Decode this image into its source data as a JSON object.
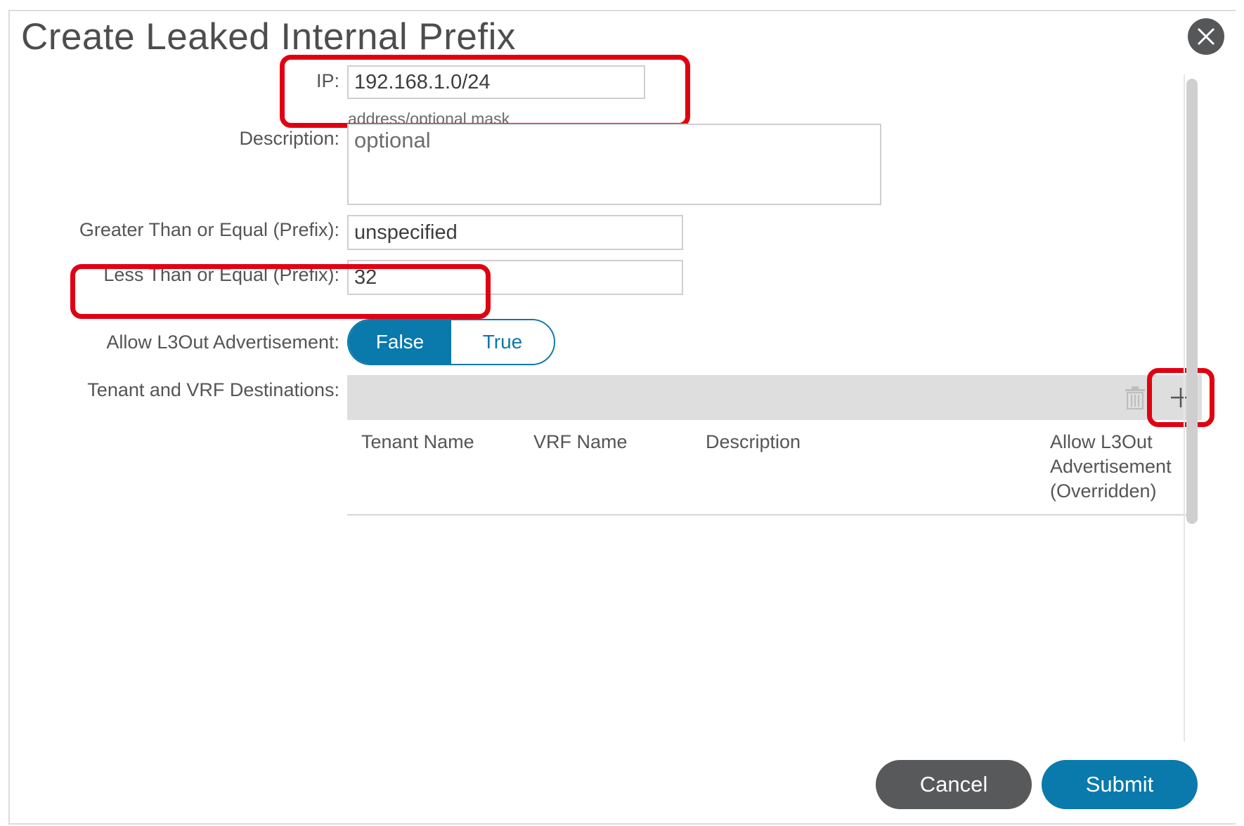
{
  "dialog": {
    "title": "Create Leaked Internal Prefix"
  },
  "form": {
    "ip": {
      "label": "IP:",
      "value": "192.168.1.0/24",
      "hint": "address/optional mask"
    },
    "description": {
      "label": "Description:",
      "placeholder": "optional"
    },
    "ge_prefix": {
      "label": "Greater Than or Equal (Prefix):",
      "value": "unspecified"
    },
    "le_prefix": {
      "label": "Less Than or Equal (Prefix):",
      "value": "32"
    },
    "allow_l3out": {
      "label": "Allow L3Out Advertisement:",
      "options": [
        "False",
        "True"
      ],
      "selected": "False"
    },
    "destinations": {
      "label": "Tenant and VRF Destinations:",
      "columns": {
        "tenant": "Tenant Name",
        "vrf": "VRF Name",
        "description": "Description",
        "allow_l3out": "Allow L3Out Advertisement (Overridden)"
      }
    }
  },
  "footer": {
    "cancel_label": "Cancel",
    "submit_label": "Submit"
  },
  "colors": {
    "accent": "#0a79ac",
    "highlight": "#e00012",
    "cancel": "#58595b"
  }
}
